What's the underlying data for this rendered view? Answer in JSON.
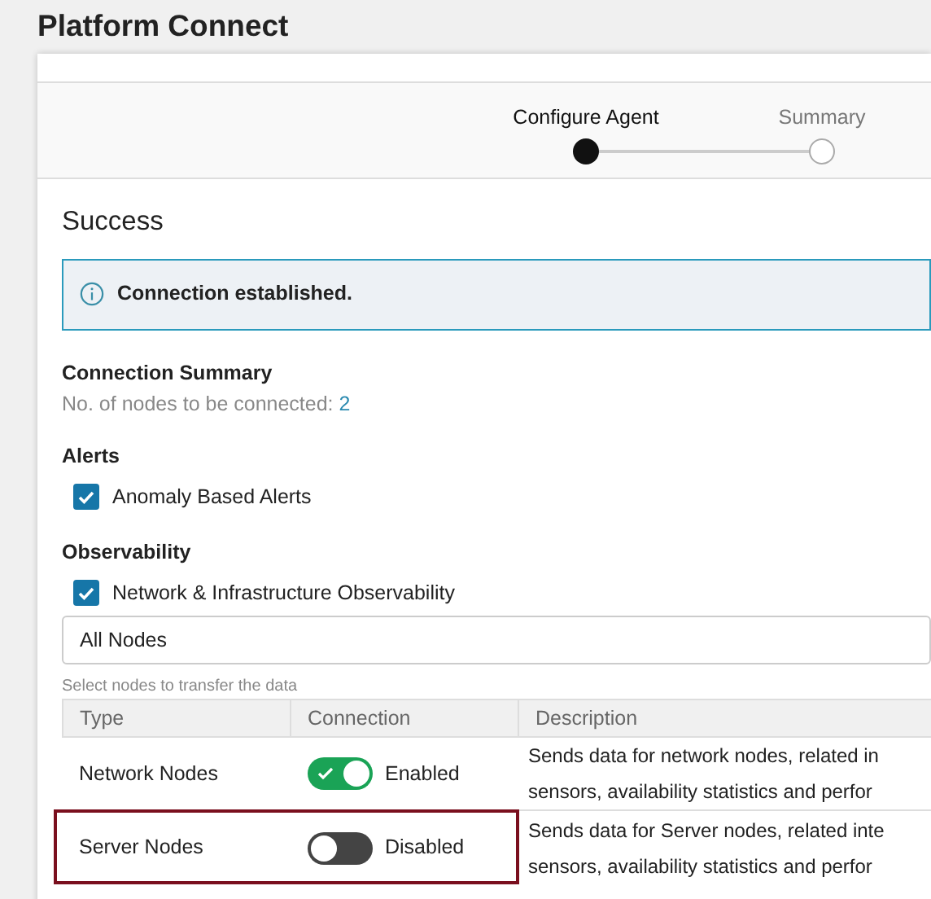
{
  "title": "Platform Connect",
  "steps": [
    {
      "label": "Configure Agent",
      "selected": true
    },
    {
      "label": "Summary",
      "selected": false
    }
  ],
  "section_title": "Success",
  "alert": {
    "text": "Connection established."
  },
  "summary": {
    "heading": "Connection Summary",
    "label": "No. of nodes to be connected: ",
    "count": "2"
  },
  "groups": [
    {
      "heading": "Alerts",
      "options": [
        {
          "label": "Anomaly Based Alerts",
          "checked": true
        }
      ]
    },
    {
      "heading": "Observability",
      "options": [
        {
          "label": "Network & Infrastructure Observability",
          "checked": true
        }
      ]
    }
  ],
  "node_select": {
    "value": "All Nodes",
    "hint": "Select nodes to transfer the data"
  },
  "table": {
    "columns": [
      "Type",
      "Connection",
      "Description"
    ],
    "rows": [
      {
        "type": "Network Nodes",
        "on": true,
        "status": "Enabled",
        "highlighted": false,
        "description": [
          "Sends data for network nodes, related in",
          "sensors, availability statistics and perfor"
        ]
      },
      {
        "type": "Server Nodes",
        "on": false,
        "status": "Disabled",
        "highlighted": true,
        "description": [
          "Sends data for Server nodes, related inte",
          "sensors, availability statistics and perfor"
        ]
      }
    ]
  }
}
